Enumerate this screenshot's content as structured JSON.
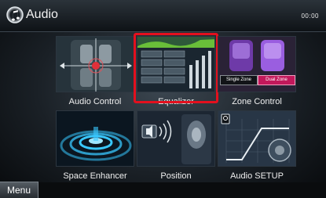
{
  "header": {
    "title": "Audio",
    "time": "00:00"
  },
  "tiles": [
    {
      "label": "Audio Control"
    },
    {
      "label": "Equalizer",
      "selected": true
    },
    {
      "label": "Zone Control",
      "thumb": {
        "left_tag": "Single Zone",
        "right_tag": "Dual Zone"
      }
    },
    {
      "label": "Space Enhancer"
    },
    {
      "label": "Position"
    },
    {
      "label": "Audio SETUP"
    }
  ],
  "footer": {
    "menu_label": "Menu"
  },
  "colors": {
    "selection": "#e3101e",
    "eq_green": "#7ee03a",
    "zone_purple": "#9a5ee0",
    "enhancer_cyan": "#39c8ff"
  },
  "icons": {
    "app": "music-note-icon"
  }
}
